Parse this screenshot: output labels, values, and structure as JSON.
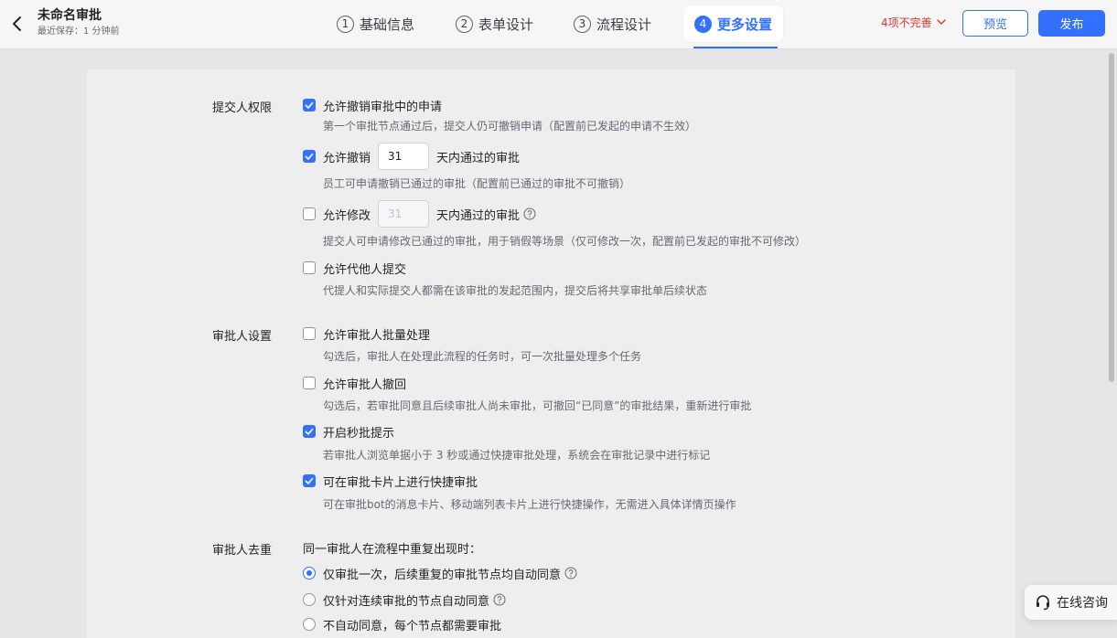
{
  "header": {
    "title": "未命名审批",
    "save_status": "最近保存：1 分钟前",
    "steps": [
      {
        "num": "1",
        "label": "基础信息"
      },
      {
        "num": "2",
        "label": "表单设计"
      },
      {
        "num": "3",
        "label": "流程设计"
      },
      {
        "num": "4",
        "label": "更多设置"
      }
    ],
    "incomplete": "4项不完善",
    "preview_label": "预览",
    "publish_label": "发布"
  },
  "submitter": {
    "label": "提交人权限",
    "options": [
      {
        "label": "允许撤销审批中的申请",
        "checked": true,
        "desc": "第一个审批节点通过后，提交人仍可撤销申请（配置前已发起的申请不生效）"
      },
      {
        "label": "允许撤销",
        "checked": true,
        "input_value": "31",
        "suffix": "天内通过的审批",
        "desc": "员工可申请撤销已通过的审批（配置前已通过的审批不可撤销）"
      },
      {
        "label": "允许修改",
        "checked": false,
        "input_value": "31",
        "suffix": "天内通过的审批",
        "desc": "提交人可申请修改已通过的审批，用于销假等场景（仅可修改一次，配置前已发起的审批不可修改）"
      },
      {
        "label": "允许代他人提交",
        "checked": false,
        "desc": "代提人和实际提交人都需在该审批的发起范围内，提交后将共享审批单后续状态"
      }
    ]
  },
  "approver": {
    "label": "审批人设置",
    "options": [
      {
        "label": "允许审批人批量处理",
        "checked": false,
        "desc": "勾选后，审批人在处理此流程的任务时，可一次批量处理多个任务"
      },
      {
        "label": "允许审批人撤回",
        "checked": false,
        "desc": "勾选后，若审批同意且后续审批人尚未审批，可撤回“已同意”的审批结果，重新进行审批"
      },
      {
        "label": "开启秒批提示",
        "checked": true,
        "desc": "若审批人浏览单据小于 3 秒或通过快捷审批处理，系统会在审批记录中进行标记"
      },
      {
        "label": "可在审批卡片上进行快捷审批",
        "checked": true,
        "desc": "可在审批bot的消息卡片、移动端列表卡片上进行快捷操作，无需进入具体详情页操作"
      }
    ]
  },
  "dedupe": {
    "label": "审批人去重",
    "intro": "同一审批人在流程中重复出现时：",
    "options": [
      {
        "label": "仅审批一次，后续重复的审批节点均自动同意",
        "selected": true
      },
      {
        "label": "仅针对连续审批的节点自动同意",
        "selected": false
      },
      {
        "label": "不自动同意，每个节点都需要审批",
        "selected": false
      }
    ]
  },
  "consult_label": "在线咨询",
  "colors": {
    "accent": "#3370ff",
    "warning": "#d83931"
  }
}
